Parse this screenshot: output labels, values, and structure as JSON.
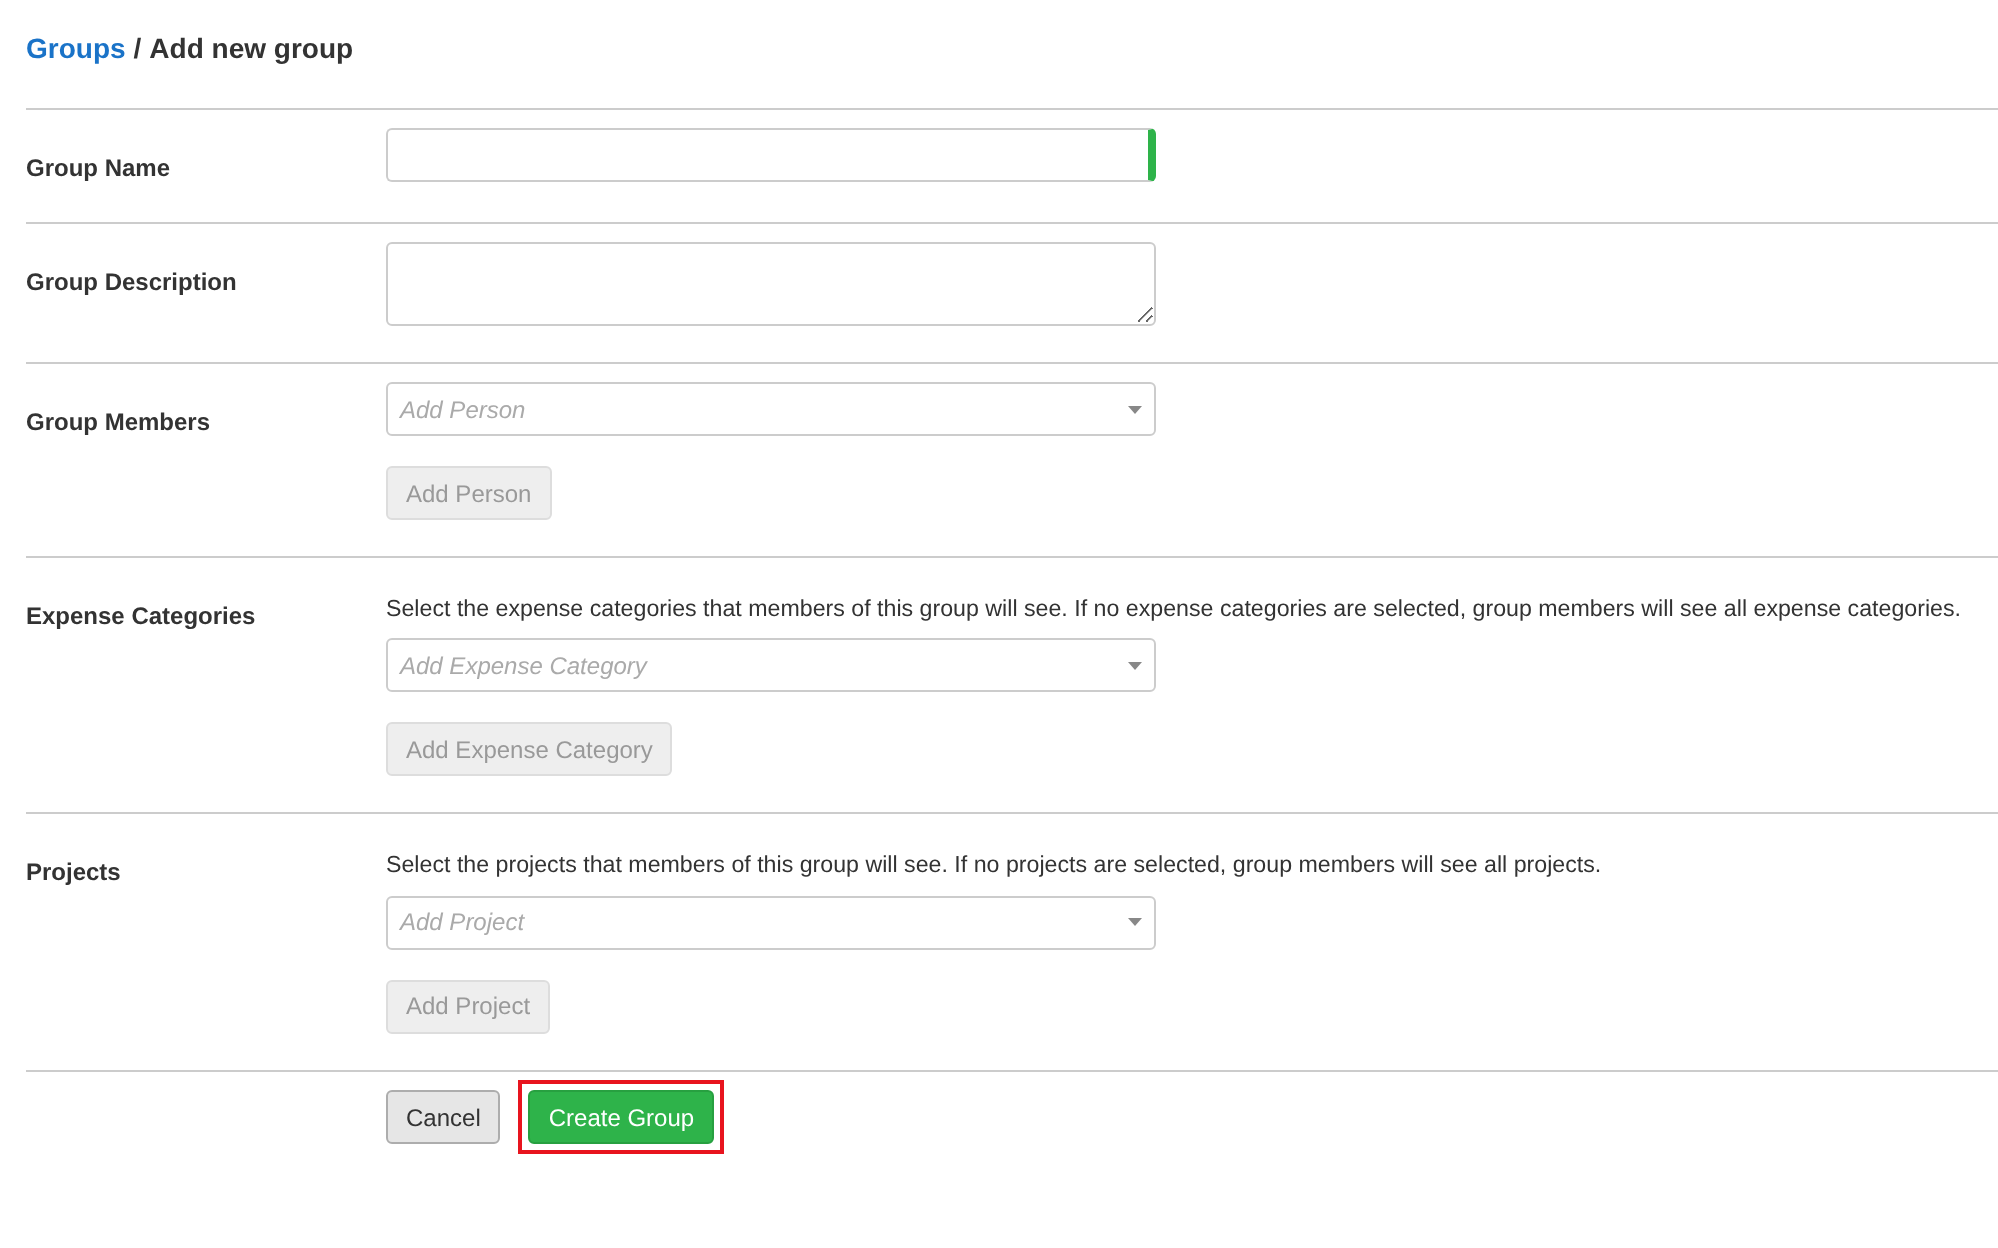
{
  "breadcrumb": {
    "link": "Groups",
    "separator": "/",
    "current": "Add new group"
  },
  "rows": [
    {
      "label": "Group Name",
      "kind": "text",
      "required": true
    },
    {
      "label": "Group Description",
      "kind": "textarea",
      "required": false
    },
    {
      "label": "Group Members",
      "kind": "select",
      "placeholder": "Add Person",
      "button": {
        "label": "Add Person",
        "disabled": true
      }
    },
    {
      "label": "Expense Categories",
      "kind": "select",
      "description": "Select the expense categories that members of this group will see. If no expense categories are selected, group members will see all expense categories.",
      "placeholder": "Add Expense Category",
      "button": {
        "label": "Add Expense Category",
        "disabled": true
      }
    },
    {
      "label": "Projects",
      "kind": "select",
      "description": "Select the projects that members of this group will see. If no projects are selected, group members will see all projects.",
      "placeholder": "Add Project",
      "button": {
        "label": "Add Project",
        "disabled": true
      }
    }
  ],
  "actions": [
    {
      "label": "Cancel",
      "kind": "default",
      "highlighted": false
    },
    {
      "label": "Create Group",
      "kind": "primary",
      "highlighted": true
    }
  ]
}
